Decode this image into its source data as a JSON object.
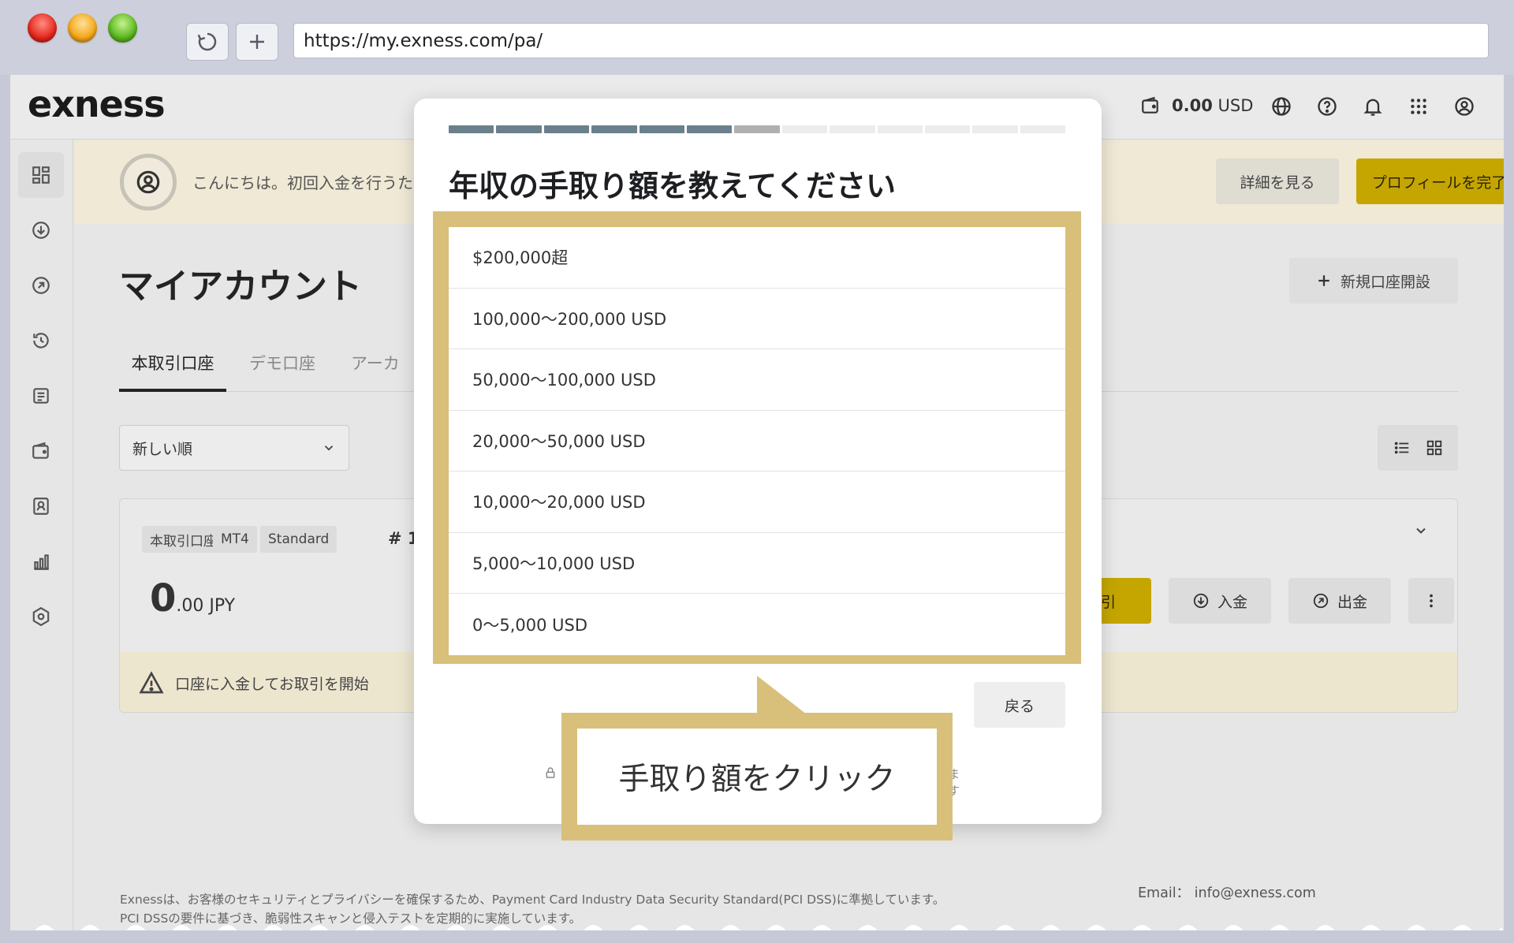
{
  "browser": {
    "url": "https://my.exness.com/pa/"
  },
  "topbar": {
    "logo": "exness",
    "balance_value": "0.00",
    "balance_currency": "USD"
  },
  "banner": {
    "text": "こんにちは。初回入金を行うた",
    "details_button": "詳細を見る",
    "profile_button": "プロフィールを完了"
  },
  "main": {
    "title": "マイアカウント",
    "new_account_button": "新規口座開設",
    "tabs": [
      {
        "label": "本取引口座",
        "active": true
      },
      {
        "label": "デモ口座",
        "active": false
      },
      {
        "label": "アーカ",
        "active": false
      }
    ],
    "sort_select": "新しい順"
  },
  "account_card": {
    "tags": [
      "本取引口座",
      "MT4",
      "Standard"
    ],
    "account_number": "# 1",
    "balance_int": "0",
    "balance_rest": ".00 JPY",
    "trade_button": "取引",
    "deposit_button": "入金",
    "withdraw_button": "出金",
    "warning": "口座に入金してお取引を開始"
  },
  "modal": {
    "progress_total": 13,
    "progress_done": 6,
    "title": "年収の手取り額を教えてください",
    "options": [
      "$200,000超",
      "100,000～200,000 USD",
      "50,000～100,000 USD",
      "20,000～50,000 USD",
      "10,000～20,000 USD",
      "5,000～10,000 USD",
      "0～5,000 USD"
    ],
    "back_button": "戻る",
    "note_suffix": "ます"
  },
  "callout": {
    "text": "手取り額をクリック"
  },
  "footer": {
    "disclaimer": "Exnessは、お客様のセキュリティとプライバシーを確保するため、Payment Card Industry Data Security Standard(PCI DSS)に準拠しています。PCI DSSの要件に基づき、脆弱性スキャンと侵入テストを定期的に実施しています。",
    "email_label": "Email：",
    "email": "info@exness.com"
  },
  "colors": {
    "brand_yellow": "#c5a600",
    "highlight": "#d8c07a",
    "progress_done": "#6a808c"
  }
}
